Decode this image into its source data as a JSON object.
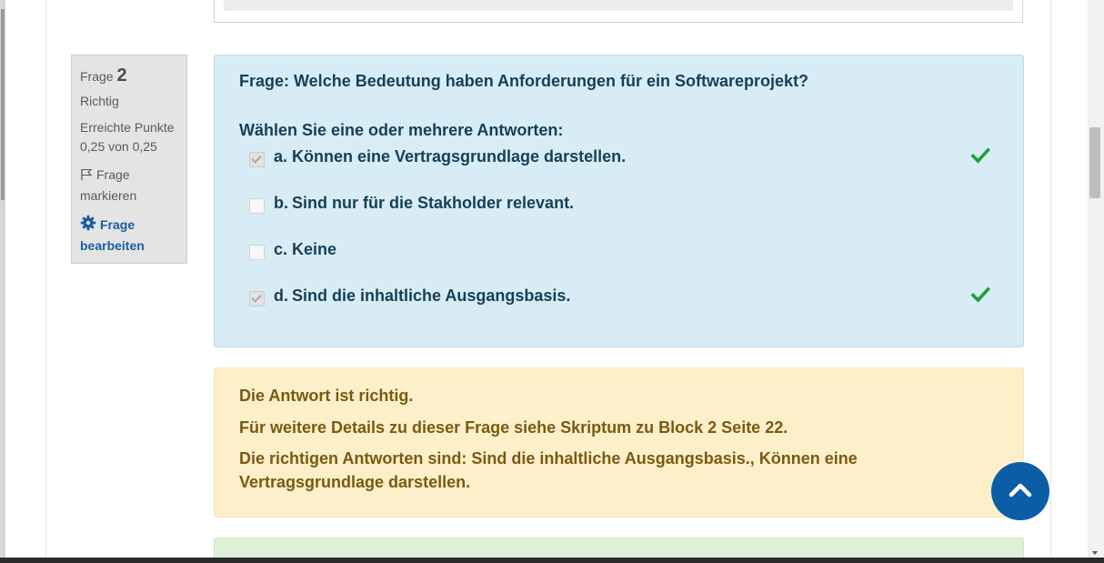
{
  "info": {
    "question_label": "Frage",
    "question_number": "2",
    "status": "Richtig",
    "points_label": "Erreichte Punkte",
    "points_value": "0,25 von 0,25",
    "flag_label": "Frage markieren",
    "edit_label": "Frage bearbeiten"
  },
  "question": {
    "text": "Frage: Welche Bedeutung haben Anforderungen für ein Softwareprojekt?",
    "prompt": "Wählen Sie eine oder mehrere Antworten:",
    "answers": [
      {
        "letter": "a.",
        "text": "Können eine Vertragsgrundlage darstellen.",
        "checked": true,
        "correct": true
      },
      {
        "letter": "b.",
        "text": "Sind nur für die Stakholder relevant.",
        "checked": false,
        "correct": false
      },
      {
        "letter": "c.",
        "text": "Keine",
        "checked": false,
        "correct": false
      },
      {
        "letter": "d.",
        "text": "Sind die inhaltliche Ausgangsbasis.",
        "checked": true,
        "correct": true
      }
    ]
  },
  "feedback": {
    "result": "Die Antwort ist richtig.",
    "details": "Für weitere Details zu dieser Frage siehe Skriptum zu Block 2 Seite 22.",
    "correct_answers": "Die richtigen Antworten sind: Sind die inhaltliche Ausgangsbasis., Können eine Vertragsgrundlage darstellen."
  },
  "colors": {
    "question_bg": "#d8ecf5",
    "feedback_bg": "#fcefc9",
    "accent": "#0b5ea6",
    "correct_tick": "#1e9e3e"
  },
  "icons": {
    "flag": "flag-icon",
    "gear": "gear-icon",
    "tick": "check-icon",
    "to_top": "chevron-up-icon"
  }
}
